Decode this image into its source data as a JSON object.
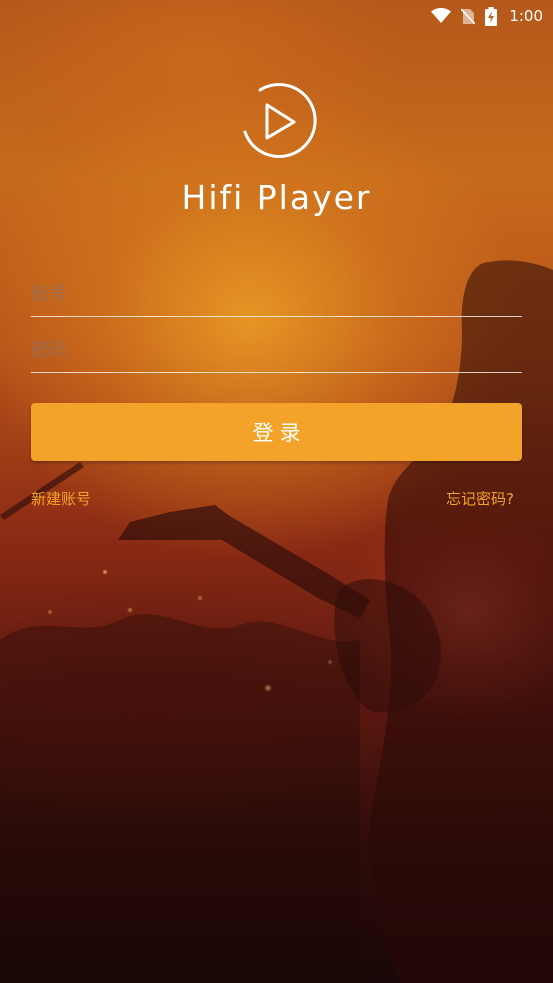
{
  "status_bar": {
    "time": "1:00",
    "icons": [
      "wifi-icon",
      "no-sim-icon",
      "battery-charging-icon"
    ]
  },
  "app": {
    "logo_icon": "play-circle-icon",
    "title": "Hifi Player"
  },
  "form": {
    "account_placeholder": "账号",
    "account_value": "",
    "password_placeholder": "密码",
    "password_value": "",
    "login_label": "登录"
  },
  "links": {
    "register": "新建账号",
    "forgot_password": "忘记密码?"
  },
  "colors": {
    "accent": "#f3a329",
    "text": "#ffffff"
  }
}
